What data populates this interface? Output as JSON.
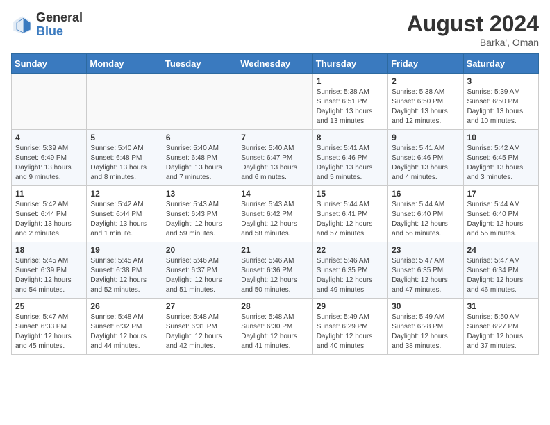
{
  "logo": {
    "general": "General",
    "blue": "Blue"
  },
  "title": {
    "month_year": "August 2024",
    "location": "Barka', Oman"
  },
  "days_header": [
    "Sunday",
    "Monday",
    "Tuesday",
    "Wednesday",
    "Thursday",
    "Friday",
    "Saturday"
  ],
  "weeks": [
    [
      {
        "day": "",
        "info": ""
      },
      {
        "day": "",
        "info": ""
      },
      {
        "day": "",
        "info": ""
      },
      {
        "day": "",
        "info": ""
      },
      {
        "day": "1",
        "info": "Sunrise: 5:38 AM\nSunset: 6:51 PM\nDaylight: 13 hours and 13 minutes."
      },
      {
        "day": "2",
        "info": "Sunrise: 5:38 AM\nSunset: 6:50 PM\nDaylight: 13 hours and 12 minutes."
      },
      {
        "day": "3",
        "info": "Sunrise: 5:39 AM\nSunset: 6:50 PM\nDaylight: 13 hours and 10 minutes."
      }
    ],
    [
      {
        "day": "4",
        "info": "Sunrise: 5:39 AM\nSunset: 6:49 PM\nDaylight: 13 hours and 9 minutes."
      },
      {
        "day": "5",
        "info": "Sunrise: 5:40 AM\nSunset: 6:48 PM\nDaylight: 13 hours and 8 minutes."
      },
      {
        "day": "6",
        "info": "Sunrise: 5:40 AM\nSunset: 6:48 PM\nDaylight: 13 hours and 7 minutes."
      },
      {
        "day": "7",
        "info": "Sunrise: 5:40 AM\nSunset: 6:47 PM\nDaylight: 13 hours and 6 minutes."
      },
      {
        "day": "8",
        "info": "Sunrise: 5:41 AM\nSunset: 6:46 PM\nDaylight: 13 hours and 5 minutes."
      },
      {
        "day": "9",
        "info": "Sunrise: 5:41 AM\nSunset: 6:46 PM\nDaylight: 13 hours and 4 minutes."
      },
      {
        "day": "10",
        "info": "Sunrise: 5:42 AM\nSunset: 6:45 PM\nDaylight: 13 hours and 3 minutes."
      }
    ],
    [
      {
        "day": "11",
        "info": "Sunrise: 5:42 AM\nSunset: 6:44 PM\nDaylight: 13 hours and 2 minutes."
      },
      {
        "day": "12",
        "info": "Sunrise: 5:42 AM\nSunset: 6:44 PM\nDaylight: 13 hours and 1 minute."
      },
      {
        "day": "13",
        "info": "Sunrise: 5:43 AM\nSunset: 6:43 PM\nDaylight: 12 hours and 59 minutes."
      },
      {
        "day": "14",
        "info": "Sunrise: 5:43 AM\nSunset: 6:42 PM\nDaylight: 12 hours and 58 minutes."
      },
      {
        "day": "15",
        "info": "Sunrise: 5:44 AM\nSunset: 6:41 PM\nDaylight: 12 hours and 57 minutes."
      },
      {
        "day": "16",
        "info": "Sunrise: 5:44 AM\nSunset: 6:40 PM\nDaylight: 12 hours and 56 minutes."
      },
      {
        "day": "17",
        "info": "Sunrise: 5:44 AM\nSunset: 6:40 PM\nDaylight: 12 hours and 55 minutes."
      }
    ],
    [
      {
        "day": "18",
        "info": "Sunrise: 5:45 AM\nSunset: 6:39 PM\nDaylight: 12 hours and 54 minutes."
      },
      {
        "day": "19",
        "info": "Sunrise: 5:45 AM\nSunset: 6:38 PM\nDaylight: 12 hours and 52 minutes."
      },
      {
        "day": "20",
        "info": "Sunrise: 5:46 AM\nSunset: 6:37 PM\nDaylight: 12 hours and 51 minutes."
      },
      {
        "day": "21",
        "info": "Sunrise: 5:46 AM\nSunset: 6:36 PM\nDaylight: 12 hours and 50 minutes."
      },
      {
        "day": "22",
        "info": "Sunrise: 5:46 AM\nSunset: 6:35 PM\nDaylight: 12 hours and 49 minutes."
      },
      {
        "day": "23",
        "info": "Sunrise: 5:47 AM\nSunset: 6:35 PM\nDaylight: 12 hours and 47 minutes."
      },
      {
        "day": "24",
        "info": "Sunrise: 5:47 AM\nSunset: 6:34 PM\nDaylight: 12 hours and 46 minutes."
      }
    ],
    [
      {
        "day": "25",
        "info": "Sunrise: 5:47 AM\nSunset: 6:33 PM\nDaylight: 12 hours and 45 minutes."
      },
      {
        "day": "26",
        "info": "Sunrise: 5:48 AM\nSunset: 6:32 PM\nDaylight: 12 hours and 44 minutes."
      },
      {
        "day": "27",
        "info": "Sunrise: 5:48 AM\nSunset: 6:31 PM\nDaylight: 12 hours and 42 minutes."
      },
      {
        "day": "28",
        "info": "Sunrise: 5:48 AM\nSunset: 6:30 PM\nDaylight: 12 hours and 41 minutes."
      },
      {
        "day": "29",
        "info": "Sunrise: 5:49 AM\nSunset: 6:29 PM\nDaylight: 12 hours and 40 minutes."
      },
      {
        "day": "30",
        "info": "Sunrise: 5:49 AM\nSunset: 6:28 PM\nDaylight: 12 hours and 38 minutes."
      },
      {
        "day": "31",
        "info": "Sunrise: 5:50 AM\nSunset: 6:27 PM\nDaylight: 12 hours and 37 minutes."
      }
    ]
  ]
}
